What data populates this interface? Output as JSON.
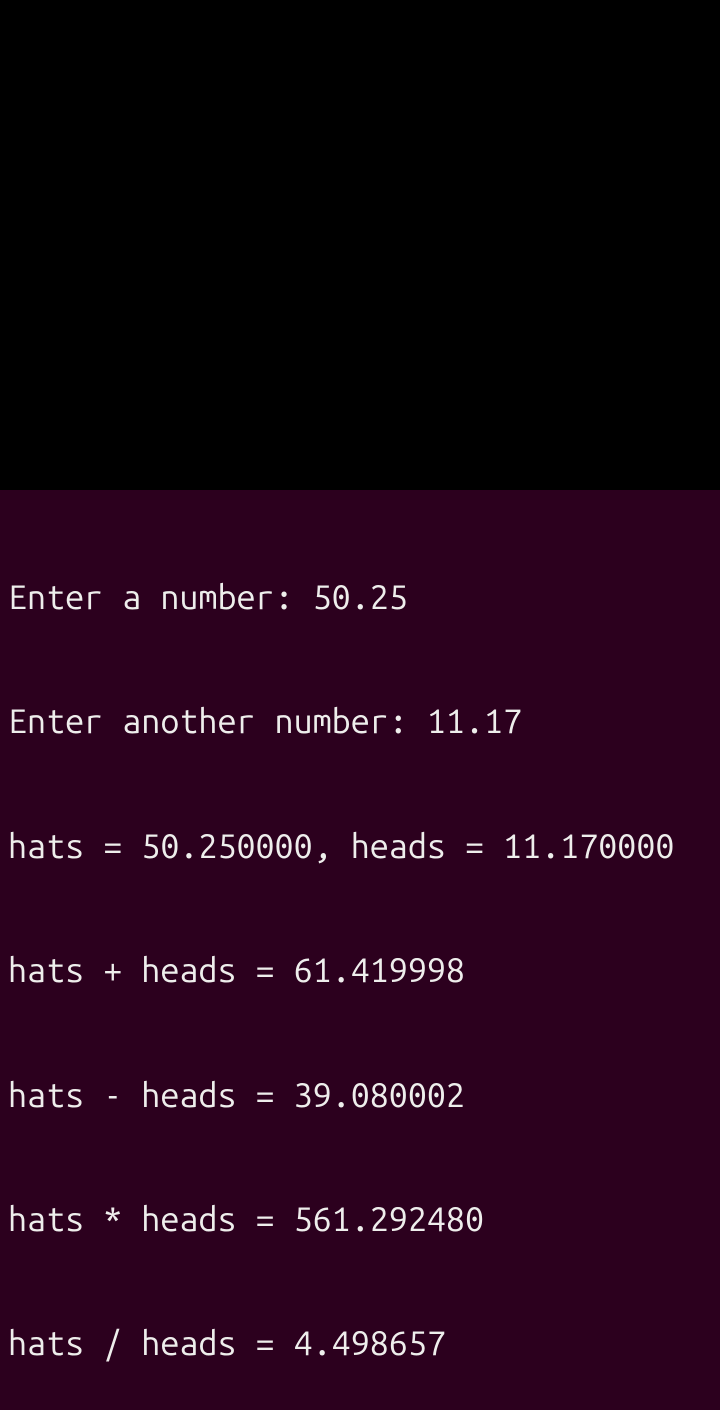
{
  "terminal": {
    "lines": [
      "Enter a number: 50.25",
      "Enter another number: 11.17",
      "hats = 50.250000, heads = 11.170000",
      "hats + heads = 61.419998",
      "hats - heads = 39.080002",
      "hats * heads = 561.292480",
      "hats / heads = 4.498657"
    ]
  }
}
